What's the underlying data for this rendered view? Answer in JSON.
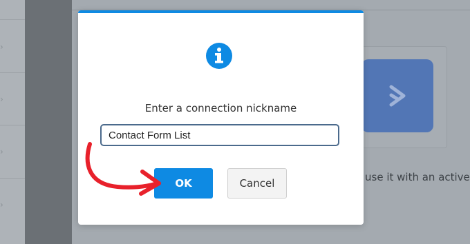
{
  "background": {
    "partial_text": "use it with an active A",
    "logo_color": "#5276b5",
    "logo_icon": "chevron-right-icon"
  },
  "dialog": {
    "icon": "info-icon",
    "prompt": "Enter a connection nickname",
    "input": {
      "value": "Contact Form List",
      "placeholder": ""
    },
    "ok_label": "OK",
    "cancel_label": "Cancel",
    "accent_color": "#0e8ae3"
  },
  "annotation": {
    "type": "red-arrow",
    "color": "#e8212b",
    "target": "ok-button"
  }
}
